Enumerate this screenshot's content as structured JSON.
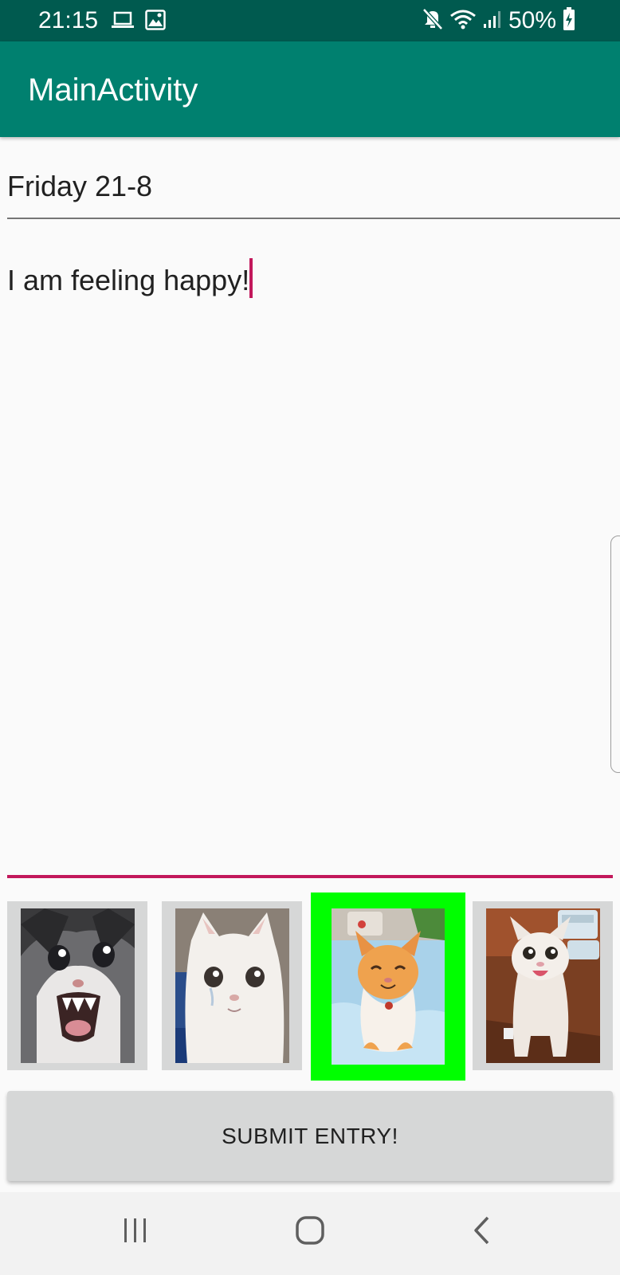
{
  "status_bar": {
    "time": "21:15",
    "battery": "50%",
    "icons_left": [
      "laptop-icon",
      "image-icon"
    ],
    "icons_right": [
      "mute-icon",
      "wifi-icon",
      "signal-icon",
      "battery-icon"
    ]
  },
  "app_bar": {
    "title": "MainActivity"
  },
  "form": {
    "date_value": "Friday 21-8",
    "entry_value": "I am feeling happy!"
  },
  "moods": {
    "options": [
      {
        "name": "mood-option-scared-cat",
        "selected": false
      },
      {
        "name": "mood-option-sad-cat",
        "selected": false
      },
      {
        "name": "mood-option-happy-cat",
        "selected": true
      },
      {
        "name": "mood-option-excited-cat",
        "selected": false
      }
    ],
    "selected_color": "#00ff00"
  },
  "submit": {
    "label": "SUBMIT ENTRY!"
  },
  "nav_bar": {
    "icons": [
      "recent-apps-icon",
      "home-icon",
      "back-icon"
    ]
  },
  "colors": {
    "status_bar": "#005a4f",
    "app_bar": "#00806f",
    "accent": "#c2185b",
    "button": "#d6d7d7"
  }
}
